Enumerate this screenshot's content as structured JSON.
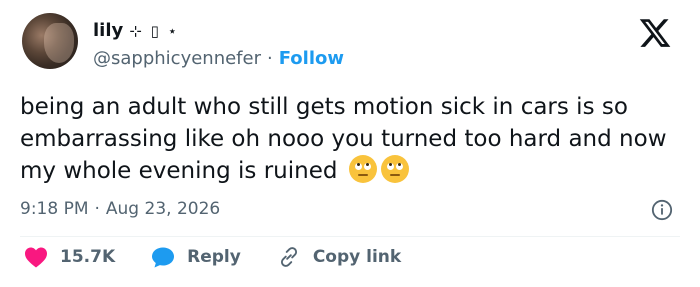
{
  "author": {
    "display_name": "lily",
    "name_glyphs": "⊹ ▯ ⋆",
    "handle": "@sapphicyennefer",
    "separator": "·",
    "follow_label": "Follow"
  },
  "tweet": {
    "text": "being an adult who still gets motion sick in cars is so embarrassing like oh nooo you turned too hard and now my whole evening is ruined",
    "emojis": [
      "eye-roll-emoji",
      "eye-roll-emoji"
    ]
  },
  "meta": {
    "time": "9:18 PM",
    "separator": "·",
    "date": "Aug 23, 2026"
  },
  "actions": {
    "like_count": "15.7K",
    "reply_label": "Reply",
    "copy_label": "Copy link"
  },
  "icons": {
    "brand": "x-logo-icon",
    "info": "info-icon",
    "like": "heart-icon",
    "reply": "reply-bubble-icon",
    "copy": "link-icon"
  },
  "colors": {
    "accent": "#1d9bf0",
    "heart": "#f91880",
    "muted": "#536471",
    "text": "#0f1419"
  }
}
